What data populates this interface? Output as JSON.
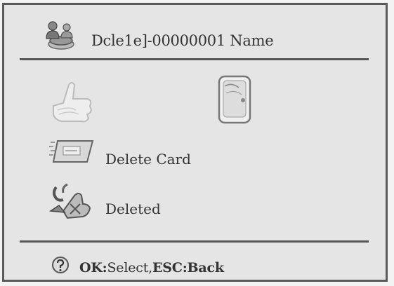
{
  "header": {
    "icon": "users-db-icon",
    "title": "Dcle1e]-00000001  Name"
  },
  "options": {
    "fingerprint_icon": "fingerprint-hand-icon",
    "card_icon": "card-icon",
    "delete_card": {
      "icon": "card-swipe-icon",
      "label": "Delete Card"
    },
    "deleted": {
      "icon": "fingerprint-deleted-icon",
      "label": "Deleted"
    }
  },
  "footer": {
    "icon": "help-icon",
    "ok_key": "OK:",
    "ok_text": "Select,",
    "esc_key": "ESC:",
    "esc_text": "Back"
  }
}
